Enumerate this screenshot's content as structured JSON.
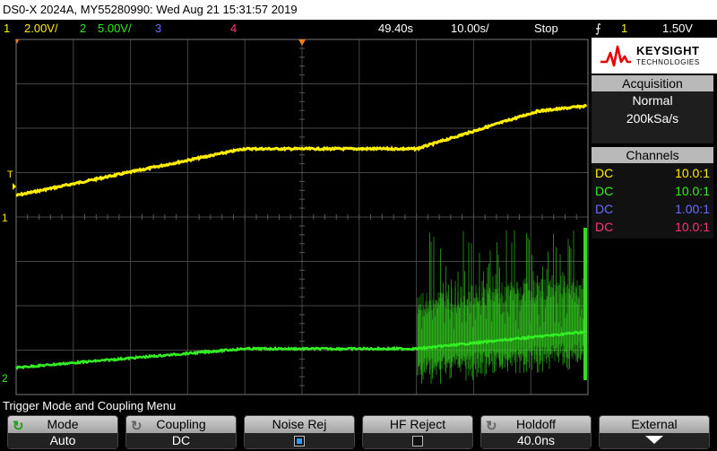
{
  "header": {
    "title": "DS0-X 2024A, MY55280990: Wed Aug 21 15:31:57 2019"
  },
  "status": {
    "ch1_num": "1",
    "ch1_scale": "2.00V/",
    "ch2_num": "2",
    "ch2_scale": "5.00V/",
    "ch3_num": "3",
    "ch4_num": "4",
    "time_offset": "49.40s",
    "timebase": "10.00s/",
    "run_state": "Stop",
    "trigger_icon": "trigger-edge-icon",
    "trigger_channel": "1",
    "trigger_level": "1.50V"
  },
  "colors": {
    "ch1": "#ffee00",
    "ch2": "#33ee22",
    "ch3": "#6a6aff",
    "ch4": "#ff3377",
    "grid": "#5a5a5a"
  },
  "logo": {
    "brand": "KEYSIGHT",
    "sub": "TECHNOLOGIES"
  },
  "acquisition": {
    "header": "Acquisition",
    "mode": "Normal",
    "rate": "200kSa/s"
  },
  "channels": {
    "header": "Channels",
    "rows": [
      {
        "coupling": "DC",
        "probe": "10.0:1"
      },
      {
        "coupling": "DC",
        "probe": "10.0:1"
      },
      {
        "coupling": "DC",
        "probe": "1.00:1"
      },
      {
        "coupling": "DC",
        "probe": "10.0:1"
      }
    ]
  },
  "markers": {
    "trigger": "T",
    "ch1": "1",
    "ch2": "2"
  },
  "menu": {
    "title": "Trigger Mode and Coupling Menu",
    "softkeys": [
      {
        "label": "Mode",
        "value": "Auto"
      },
      {
        "label": "Coupling",
        "value": "DC"
      },
      {
        "label": "Noise Rej",
        "checked": true
      },
      {
        "label": "HF Reject",
        "checked": false
      },
      {
        "label": "Holdoff",
        "value": "40.0ns"
      },
      {
        "label": "External"
      }
    ]
  }
}
